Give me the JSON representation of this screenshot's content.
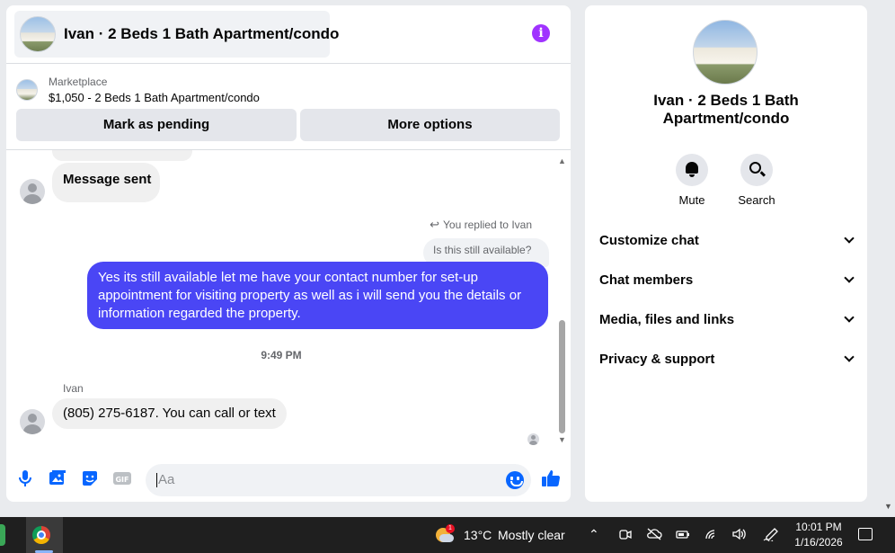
{
  "chat": {
    "title": "Ivan · 2 Beds 1 Bath Apartment/condo",
    "marketplace_label": "Marketplace",
    "listing": "$1,050 - 2 Beds 1 Bath Apartment/condo",
    "btn_pending": "Mark as pending",
    "btn_more": "More options",
    "messages": {
      "sent_notice": "Message sent",
      "reply_label": "You replied to Ivan",
      "quoted": "Is this still available?",
      "outgoing": "Yes its still available let me have your contact number for set-up appointment for visiting property as well as i will send you the details or information regarded the property.",
      "time": "9:49 PM",
      "sender": "Ivan",
      "incoming": "(805) 275-6187. You can call or text"
    },
    "composer": {
      "placeholder": "Aa",
      "icons": [
        "microphone-icon",
        "photo-icon",
        "sticker-icon",
        "gif-icon",
        "emoji-icon",
        "thumbs-up-icon"
      ],
      "gif_label": "GIF"
    }
  },
  "side": {
    "name": "Ivan · 2 Beds 1 Bath Apartment/condo",
    "actions": [
      {
        "label": "Mute",
        "icon": "bell-icon"
      },
      {
        "label": "Search",
        "icon": "search-icon"
      }
    ],
    "rows": [
      "Customize chat",
      "Chat members",
      "Media, files and links",
      "Privacy & support"
    ]
  },
  "taskbar": {
    "temperature": "13°C",
    "condition": "Mostly clear",
    "weather_badge": "1",
    "time": "10:01 PM",
    "date": "1/16/2026"
  },
  "colors": {
    "accent": "#0866ff",
    "outgoing_bubble": "#4a46f5",
    "info_icon": "#a033ff"
  }
}
